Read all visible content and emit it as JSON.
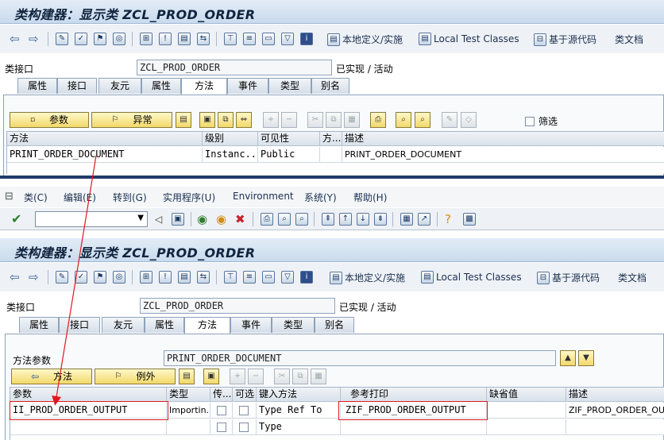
{
  "top": {
    "title": "类构建器：显示类 ZCL_PROD_ORDER",
    "toolbar": {
      "local_def": "本地定义/实施",
      "local_test": "Local Test Classes",
      "source_based": "基于源代码",
      "class_doc": "类文档"
    },
    "class_label": "类接口",
    "class_value": "ZCL_PROD_ORDER",
    "class_status": "已实现 / 活动",
    "tabs": [
      "属性",
      "接口",
      "友元",
      "属性",
      "方法",
      "事件",
      "类型",
      "别名"
    ],
    "buttons": {
      "params": "参数",
      "exceptions": "异常",
      "filter": "筛选"
    },
    "columns": [
      "方法",
      "级别",
      "可见性",
      "方...",
      "描述"
    ],
    "rows": [
      {
        "method": "PRINT_ORDER_DOCUMENT",
        "level": "Instanc...",
        "visibility": "Public",
        "flag": "",
        "desc": "PRINT_ORDER_DOCUMENT"
      }
    ]
  },
  "menu": [
    "类(C)",
    "编辑(E)",
    "转到(G)",
    "实用程序(U)",
    "Environment",
    "系统(Y)",
    "帮助(H)"
  ],
  "command_field": {
    "value": ""
  },
  "bottom": {
    "title": "类构建器：显示类 ZCL_PROD_ORDER",
    "toolbar": {
      "local_def": "本地定义/实施",
      "local_test": "Local Test Classes",
      "source_based": "基于源代码",
      "class_doc": "类文档"
    },
    "class_label": "类接口",
    "class_value": "ZCL_PROD_ORDER",
    "class_status": "已实现 / 活动",
    "tabs": [
      "属性",
      "接口",
      "友元",
      "属性",
      "方法",
      "事件",
      "类型",
      "别名"
    ],
    "method_param_label": "方法参数",
    "method_param_value": "PRINT_ORDER_DOCUMENT",
    "buttons": {
      "methods": "方法",
      "exceptions": "例外"
    },
    "columns": [
      "参数",
      "类型",
      "传...",
      "可选",
      "键入方法",
      "参考打印",
      "缺省值",
      "描述"
    ],
    "rows": [
      {
        "param": "II_PROD_ORDER_OUTPUT",
        "type": "Importin...",
        "typing": "Type Ref To",
        "ref": "ZIF_PROD_ORDER_OUTPUT",
        "default": "",
        "desc": "ZIF_PROD_ORDER_OUTPUT"
      },
      {
        "param": "",
        "type": "",
        "typing": "Type",
        "ref": "",
        "default": "",
        "desc": ""
      }
    ]
  },
  "colors": {
    "annotation": "#e0191d",
    "button_yellow": "#f2d96a",
    "title_blue": "#c9dbee"
  }
}
